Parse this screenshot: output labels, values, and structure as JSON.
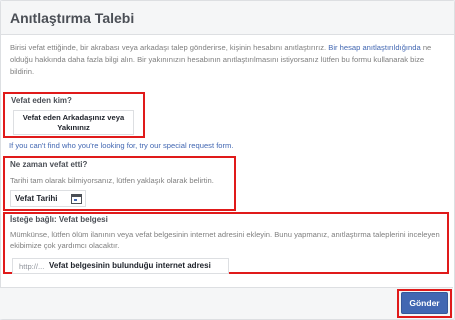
{
  "header": {
    "title": "Anıtlaştırma Talebi"
  },
  "intro": {
    "text_before_link": "Birisi vefat ettiğinde, bir akrabası veya arkadaşı talep gönderirse, kişinin hesabını anıtlaştırırız. ",
    "link": "Bir hesap anıtlaştırıldığında",
    "text_after_link": " ne olduğu hakkında daha fazla bilgi alın. Bir yakınınızın hesabının anıtlaştırılmasını istiyorsanız lütfen bu formu kullanarak bize bildirin."
  },
  "deceased": {
    "label": "Vefat eden kim?",
    "field_value": "Vefat eden Arkadaşınız veya Yakınınız",
    "help_link": "If you can't find who you're looking for, try our special request form."
  },
  "date": {
    "label": "Ne zaman vefat etti?",
    "help": "Tarihi tam olarak bilmiyorsanız, lütfen yaklaşık olarak belirtin.",
    "field_value": "Vefat Tarihi",
    "icon": "calendar-icon"
  },
  "proof": {
    "label": "İsteğe bağlı: Vefat belgesi",
    "help": "Mümkünse, lütfen ölüm ilanının veya vefat belgesinin internet adresini ekleyin. Bunu yapmanız, anıtlaştırma taleplerini inceleyen ekibimize çok yardımcı olacaktır.",
    "url_prefix": "http://...",
    "url_value": "Vefat  belgesinin bulunduğu internet adresi"
  },
  "footer": {
    "submit_label": "Gönder"
  },
  "colors": {
    "accent": "#4267b2",
    "highlight": "#e01a1a"
  }
}
